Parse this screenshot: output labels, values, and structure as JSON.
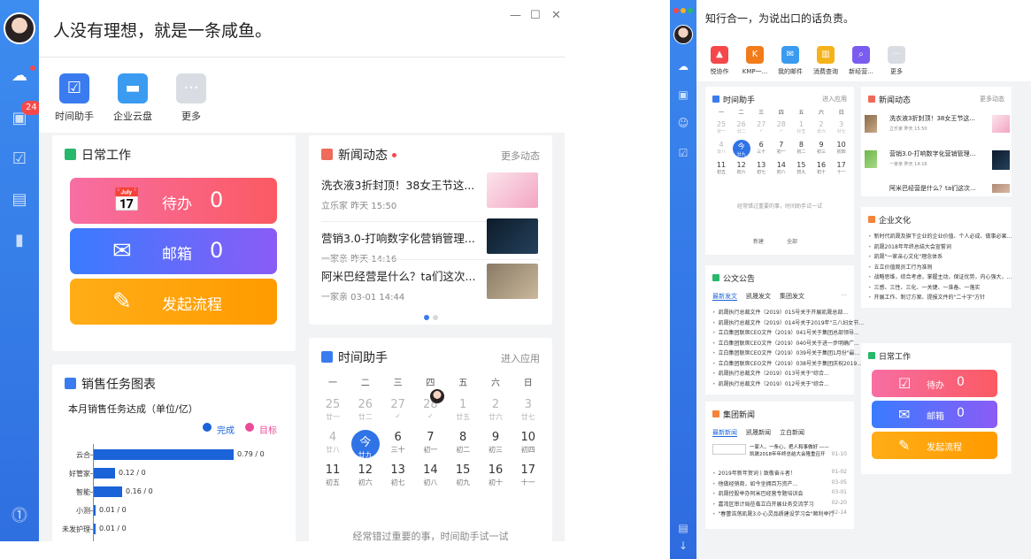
{
  "left": {
    "motto": "人没有理想，就是一条咸鱼。",
    "badge_count": "24",
    "window_controls": [
      "—",
      "☐",
      "✕"
    ],
    "apps": [
      {
        "label": "时间助手",
        "icon": "calendar-check-icon",
        "color": "#3a7bef"
      },
      {
        "label": "企业云盘",
        "icon": "folder-icon",
        "color": "#3a9bf0"
      },
      {
        "label": "更多",
        "icon": "more-icon",
        "color": "#d9dde3"
      }
    ],
    "daily_work": {
      "title": "日常工作",
      "buttons": [
        {
          "label": "待办",
          "count": "0",
          "icon": "calendar-check-icon"
        },
        {
          "label": "邮箱",
          "count": "0",
          "icon": "mail-icon"
        },
        {
          "label": "发起流程",
          "count": "",
          "icon": "edit-icon"
        }
      ]
    },
    "news": {
      "title": "新闻动态",
      "more": "更多动态",
      "items": [
        {
          "title": "洗衣液3折封顶！38女王节这...",
          "meta": "立乐家 昨天 15:50"
        },
        {
          "title": "营销3.0-打响数字化营销管理...",
          "meta": "一家亲 昨天 14:16"
        },
        {
          "title": "阿米巴经营是什么？ta们这次...",
          "meta": "一家亲 03-01 14:44"
        }
      ]
    },
    "sales_chart": {
      "title": "销售任务图表",
      "subtitle": "本月销售任务达成（单位/亿）",
      "legend": [
        {
          "label": "完成",
          "color": "#1a63d8"
        },
        {
          "label": "目标",
          "color": "#ec4b98"
        }
      ]
    },
    "time_assistant": {
      "title": "时间助手",
      "more": "进入应用",
      "weekdays": [
        "一",
        "二",
        "三",
        "四",
        "五",
        "六",
        "日"
      ],
      "weeks": [
        [
          {
            "d": "25",
            "s": "廿一",
            "past": true
          },
          {
            "d": "26",
            "s": "廿二",
            "past": true
          },
          {
            "d": "27",
            "s": "✓",
            "past": true
          },
          {
            "d": "28",
            "s": "✓",
            "past": true
          },
          {
            "d": "1",
            "s": "廿五",
            "past": true
          },
          {
            "d": "2",
            "s": "廿六",
            "past": true
          },
          {
            "d": "3",
            "s": "廿七",
            "past": true
          }
        ],
        [
          {
            "d": "4",
            "s": "廿八",
            "past": true
          },
          {
            "d": "今",
            "s": "廿九",
            "today": true
          },
          {
            "d": "6",
            "s": "三十"
          },
          {
            "d": "7",
            "s": "初一"
          },
          {
            "d": "8",
            "s": "初二"
          },
          {
            "d": "9",
            "s": "初三"
          },
          {
            "d": "10",
            "s": "初四"
          }
        ],
        [
          {
            "d": "11",
            "s": "初五"
          },
          {
            "d": "12",
            "s": "初六"
          },
          {
            "d": "13",
            "s": "初七"
          },
          {
            "d": "14",
            "s": "初八"
          },
          {
            "d": "15",
            "s": "初九"
          },
          {
            "d": "16",
            "s": "初十"
          },
          {
            "d": "17",
            "s": "十一"
          }
        ]
      ],
      "hint": "经常错过重要的事，时间助手试一试"
    }
  },
  "chart_data": {
    "type": "bar",
    "title": "本月销售任务达成（单位/亿）",
    "orientation": "horizontal",
    "categories": [
      "云合",
      "好管家",
      "智能",
      "小测",
      "未发护理"
    ],
    "series": [
      {
        "name": "完成",
        "values": [
          0.79,
          0.12,
          0.16,
          0.01,
          0.01
        ]
      },
      {
        "name": "目标",
        "values": [
          0,
          0,
          0,
          0,
          0
        ]
      }
    ],
    "value_labels": [
      "0.79 / 0",
      "0.12 / 0",
      "0.16 / 0",
      "0.01 / 0",
      "0.01 / 0"
    ],
    "xlim": [
      0,
      1
    ]
  },
  "right": {
    "motto": "知行合一，为说出口的话负责。",
    "apps": [
      {
        "label": "悦协作",
        "icon": "rocket-icon",
        "color": "#f5484a"
      },
      {
        "label": "KMP一...",
        "icon": "kmp-icon",
        "color": "#f27b1a"
      },
      {
        "label": "我的邮件",
        "icon": "mail-icon",
        "color": "#3a9bf0"
      },
      {
        "label": "消费查询",
        "icon": "chart-icon",
        "color": "#f5b21a"
      },
      {
        "label": "新经营...",
        "icon": "search-icon",
        "color": "#7a5cf0"
      },
      {
        "label": "更多",
        "icon": "more-icon",
        "color": "#d9dde3"
      }
    ],
    "time_assistant": {
      "title": "时间助手",
      "more": "进入应用",
      "hint": "经常错过重要的事，时间助手试一试",
      "actions": [
        "新建",
        "全部"
      ]
    },
    "news": {
      "title": "新闻动态",
      "more": "更多动态",
      "items": [
        {
          "title": "洗衣液3折封顶！38女王节这...",
          "meta": "立乐家 昨天 15:50"
        },
        {
          "title": "营销3.0-打响数字化营销管理...",
          "meta": "一家亲 昨天 14:16"
        },
        {
          "title": "阿米巴经营是什么？ta们这次...",
          "meta": ""
        }
      ]
    },
    "culture": {
      "title": "企业文化",
      "items": [
        "新时代凯晟及旗下企业的企业价值、个人必成、做事必果...",
        "凯晟2018年年终总结大会宣誓词",
        "凯晟\"一家亲心文化\"理念体系",
        "五立价值观员工行为准则",
        "战略思维，综合考虑，掌握主动，保证优势，内心强大，...",
        "三感、三性、三化、一关键、一准备、一落实",
        "开展工作、制订方案、提报文件的\"二十字\"方针"
      ]
    },
    "announcements": {
      "title": "公文公告",
      "tabs": [
        "最新发文",
        "凯晟发文",
        "集团发文"
      ],
      "items": [
        "凯晟执行总裁文件（2019）015号关于开展凯晟总部...",
        "凯晟执行总裁文件（2019）014号关于2019年\"三八妇女节...",
        "立白集团联席CEO文件（2019）041号关于集团总部领导...",
        "立白集团联席CEO文件（2019）040号关于进一步明确广...",
        "立白集团联席CEO文件（2019）039号关于集团1月份\"最...",
        "立白集团联席CEO文件（2019）038号关于集团庆祝2019...",
        "凯晟执行总裁文件（2019）013号关于\"综合...",
        "凯晟执行总裁文件（2019）012号关于\"综合..."
      ]
    },
    "group_news": {
      "title": "集团新闻",
      "tabs": [
        "最新新闻",
        "凯晟新闻",
        "立白新闻"
      ],
      "headline": "一家人，一条心，把人和事做好 —— 凯晟2018年年终总结大会隆重召开",
      "headline_date": "01-10",
      "items": [
        {
          "t": "2019年新年贺词丨致敬奋斗者！",
          "d": "01-02"
        },
        {
          "t": "他做经销商，如今坐拥百万资产...",
          "d": "03-05"
        },
        {
          "t": "凯晟控股举办阿米巴经营专题培训会",
          "d": "03-01"
        },
        {
          "t": "嘉湾区审计局莅临立白开展业务交流学习",
          "d": "02-20"
        },
        {
          "t": "\"春蕾浩荡凯晟3.0·心灵品质建设学习会\"顺利举行",
          "d": "02-14"
        }
      ]
    },
    "daily_work": {
      "title": "日常工作",
      "buttons": [
        {
          "label": "待办",
          "count": "0"
        },
        {
          "label": "邮箱",
          "count": "0"
        },
        {
          "label": "发起流程",
          "count": ""
        }
      ]
    }
  }
}
